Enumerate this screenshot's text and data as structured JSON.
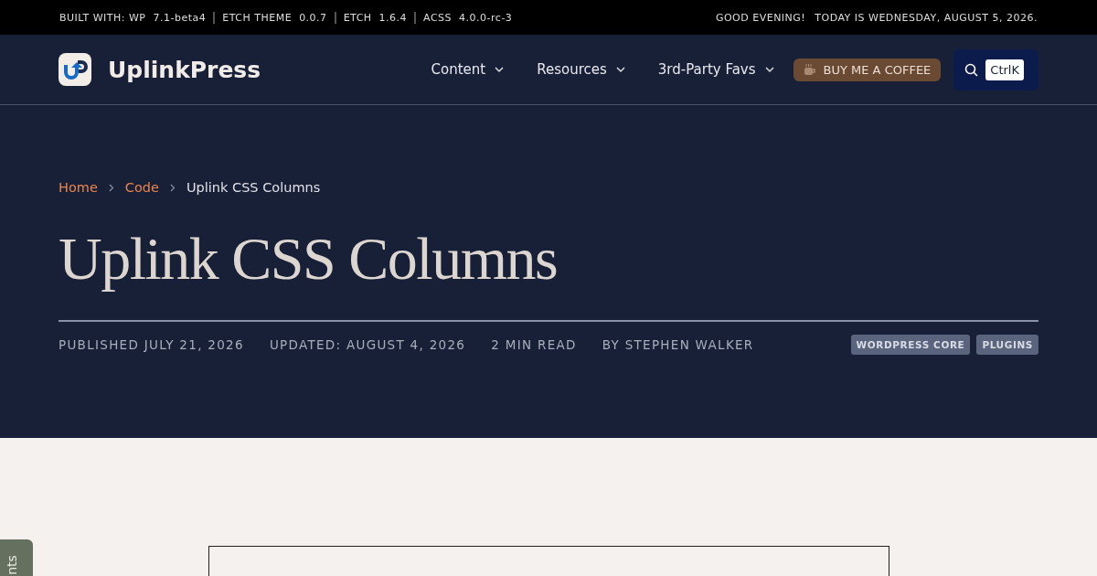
{
  "topbar": {
    "versions": [
      {
        "label": "BUILT WITH: WP",
        "value": "7.1-beta4"
      },
      {
        "label": "ETCH THEME",
        "value": "0.0.7"
      },
      {
        "label": "ETCH",
        "value": "1.6.4"
      },
      {
        "label": "ACSS",
        "value": "4.0.0-rc-3"
      }
    ],
    "greeting": "GOOD EVENING!",
    "date": "TODAY IS WEDNESDAY, AUGUST 5, 2026."
  },
  "header": {
    "brand": "UplinkPress",
    "nav": [
      {
        "label": "Content"
      },
      {
        "label": "Resources"
      },
      {
        "label": "3rd-Party Favs"
      }
    ],
    "coffee": "BUY ME A COFFEE",
    "shortcut": "CtrlK"
  },
  "breadcrumbs": [
    {
      "label": "Home",
      "kind": "link"
    },
    {
      "label": "Code",
      "kind": "link"
    },
    {
      "label": "Uplink CSS Columns",
      "kind": "current"
    }
  ],
  "title": "Uplink CSS Columns",
  "meta": [
    "PUBLISHED JULY 21, 2026",
    "UPDATED: AUGUST 4, 2026",
    "2 MIN READ",
    "BY STEPHEN WALKER"
  ],
  "tags": [
    "WORDPRESS CORE",
    "PLUGINS"
  ],
  "side_tab": "nts"
}
